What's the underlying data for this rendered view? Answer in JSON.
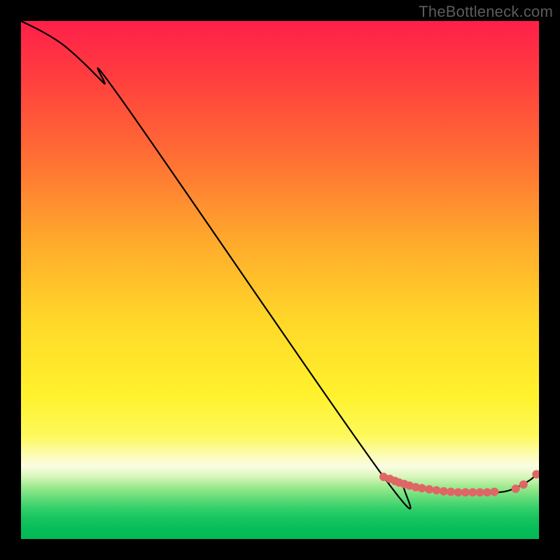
{
  "watermark": "TheBottleneck.com",
  "chart_data": {
    "type": "line",
    "title": "",
    "xlabel": "",
    "ylabel": "",
    "xlim": [
      0,
      100
    ],
    "ylim": [
      0,
      100
    ],
    "grid": false,
    "legend": false,
    "series": [
      {
        "name": "curve",
        "color": "#000000",
        "x": [
          0,
          4,
          8,
          12,
          16,
          20,
          70,
          74,
          78,
          82,
          86,
          90,
          94,
          98,
          100
        ],
        "y": [
          100,
          98,
          95.5,
          92,
          88,
          84,
          12,
          10.6,
          9.6,
          9,
          9,
          9,
          9.3,
          11.2,
          13
        ]
      }
    ],
    "markers": [
      {
        "name": "dots",
        "color": "#e06666",
        "radius_px": 6,
        "points": [
          {
            "x": 70.0,
            "y": 12.0
          },
          {
            "x": 71.2,
            "y": 11.6
          },
          {
            "x": 72.2,
            "y": 11.2
          },
          {
            "x": 73.0,
            "y": 10.9
          },
          {
            "x": 74.0,
            "y": 10.6
          },
          {
            "x": 75.0,
            "y": 10.3
          },
          {
            "x": 76.2,
            "y": 10.0
          },
          {
            "x": 77.4,
            "y": 9.8
          },
          {
            "x": 78.8,
            "y": 9.6
          },
          {
            "x": 80.2,
            "y": 9.4
          },
          {
            "x": 81.6,
            "y": 9.2
          },
          {
            "x": 83.0,
            "y": 9.1
          },
          {
            "x": 84.4,
            "y": 9.0
          },
          {
            "x": 85.8,
            "y": 9.0
          },
          {
            "x": 87.2,
            "y": 9.0
          },
          {
            "x": 88.6,
            "y": 9.0
          },
          {
            "x": 90.0,
            "y": 9.0
          },
          {
            "x": 91.4,
            "y": 9.1
          },
          {
            "x": 95.5,
            "y": 9.7
          },
          {
            "x": 97.0,
            "y": 10.5
          },
          {
            "x": 99.5,
            "y": 12.5
          }
        ]
      }
    ]
  }
}
